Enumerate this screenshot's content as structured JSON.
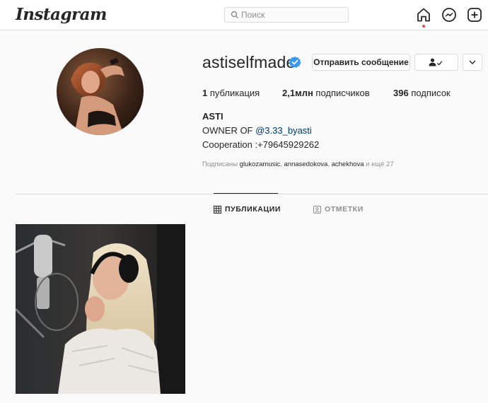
{
  "app": {
    "logo": "Instagram"
  },
  "search": {
    "placeholder": "Поиск"
  },
  "nav": {
    "icons": [
      "home-icon",
      "messenger-icon",
      "new-post-icon"
    ]
  },
  "profile": {
    "username": "astiselfmade",
    "verified": true,
    "message_button": "Отправить сообщение",
    "stats": {
      "posts_value": "1",
      "posts_label": " публикация",
      "followers_value": "2,1млн",
      "followers_label": " подписчиков",
      "following_value": "396",
      "following_label": " подписок"
    },
    "full_name": "ASTI",
    "bio_line1_prefix": "OWNER OF ",
    "bio_line1_mention": "@3.33_byasti",
    "bio_line2": "Cooperation :+79645929262",
    "followed_by": {
      "prefix": "Подписаны ",
      "names": [
        "glukozamusic",
        "annasedokova",
        "achekhova"
      ],
      "suffix": " и ещё 27"
    }
  },
  "tabs": [
    {
      "label": "ПУБЛИКАЦИИ",
      "active": true
    },
    {
      "label": "ОТМЕТКИ",
      "active": false
    }
  ],
  "colors": {
    "accent_link": "#00376b",
    "verified_blue": "#3897f0",
    "notification_dot": "#ed4956"
  }
}
